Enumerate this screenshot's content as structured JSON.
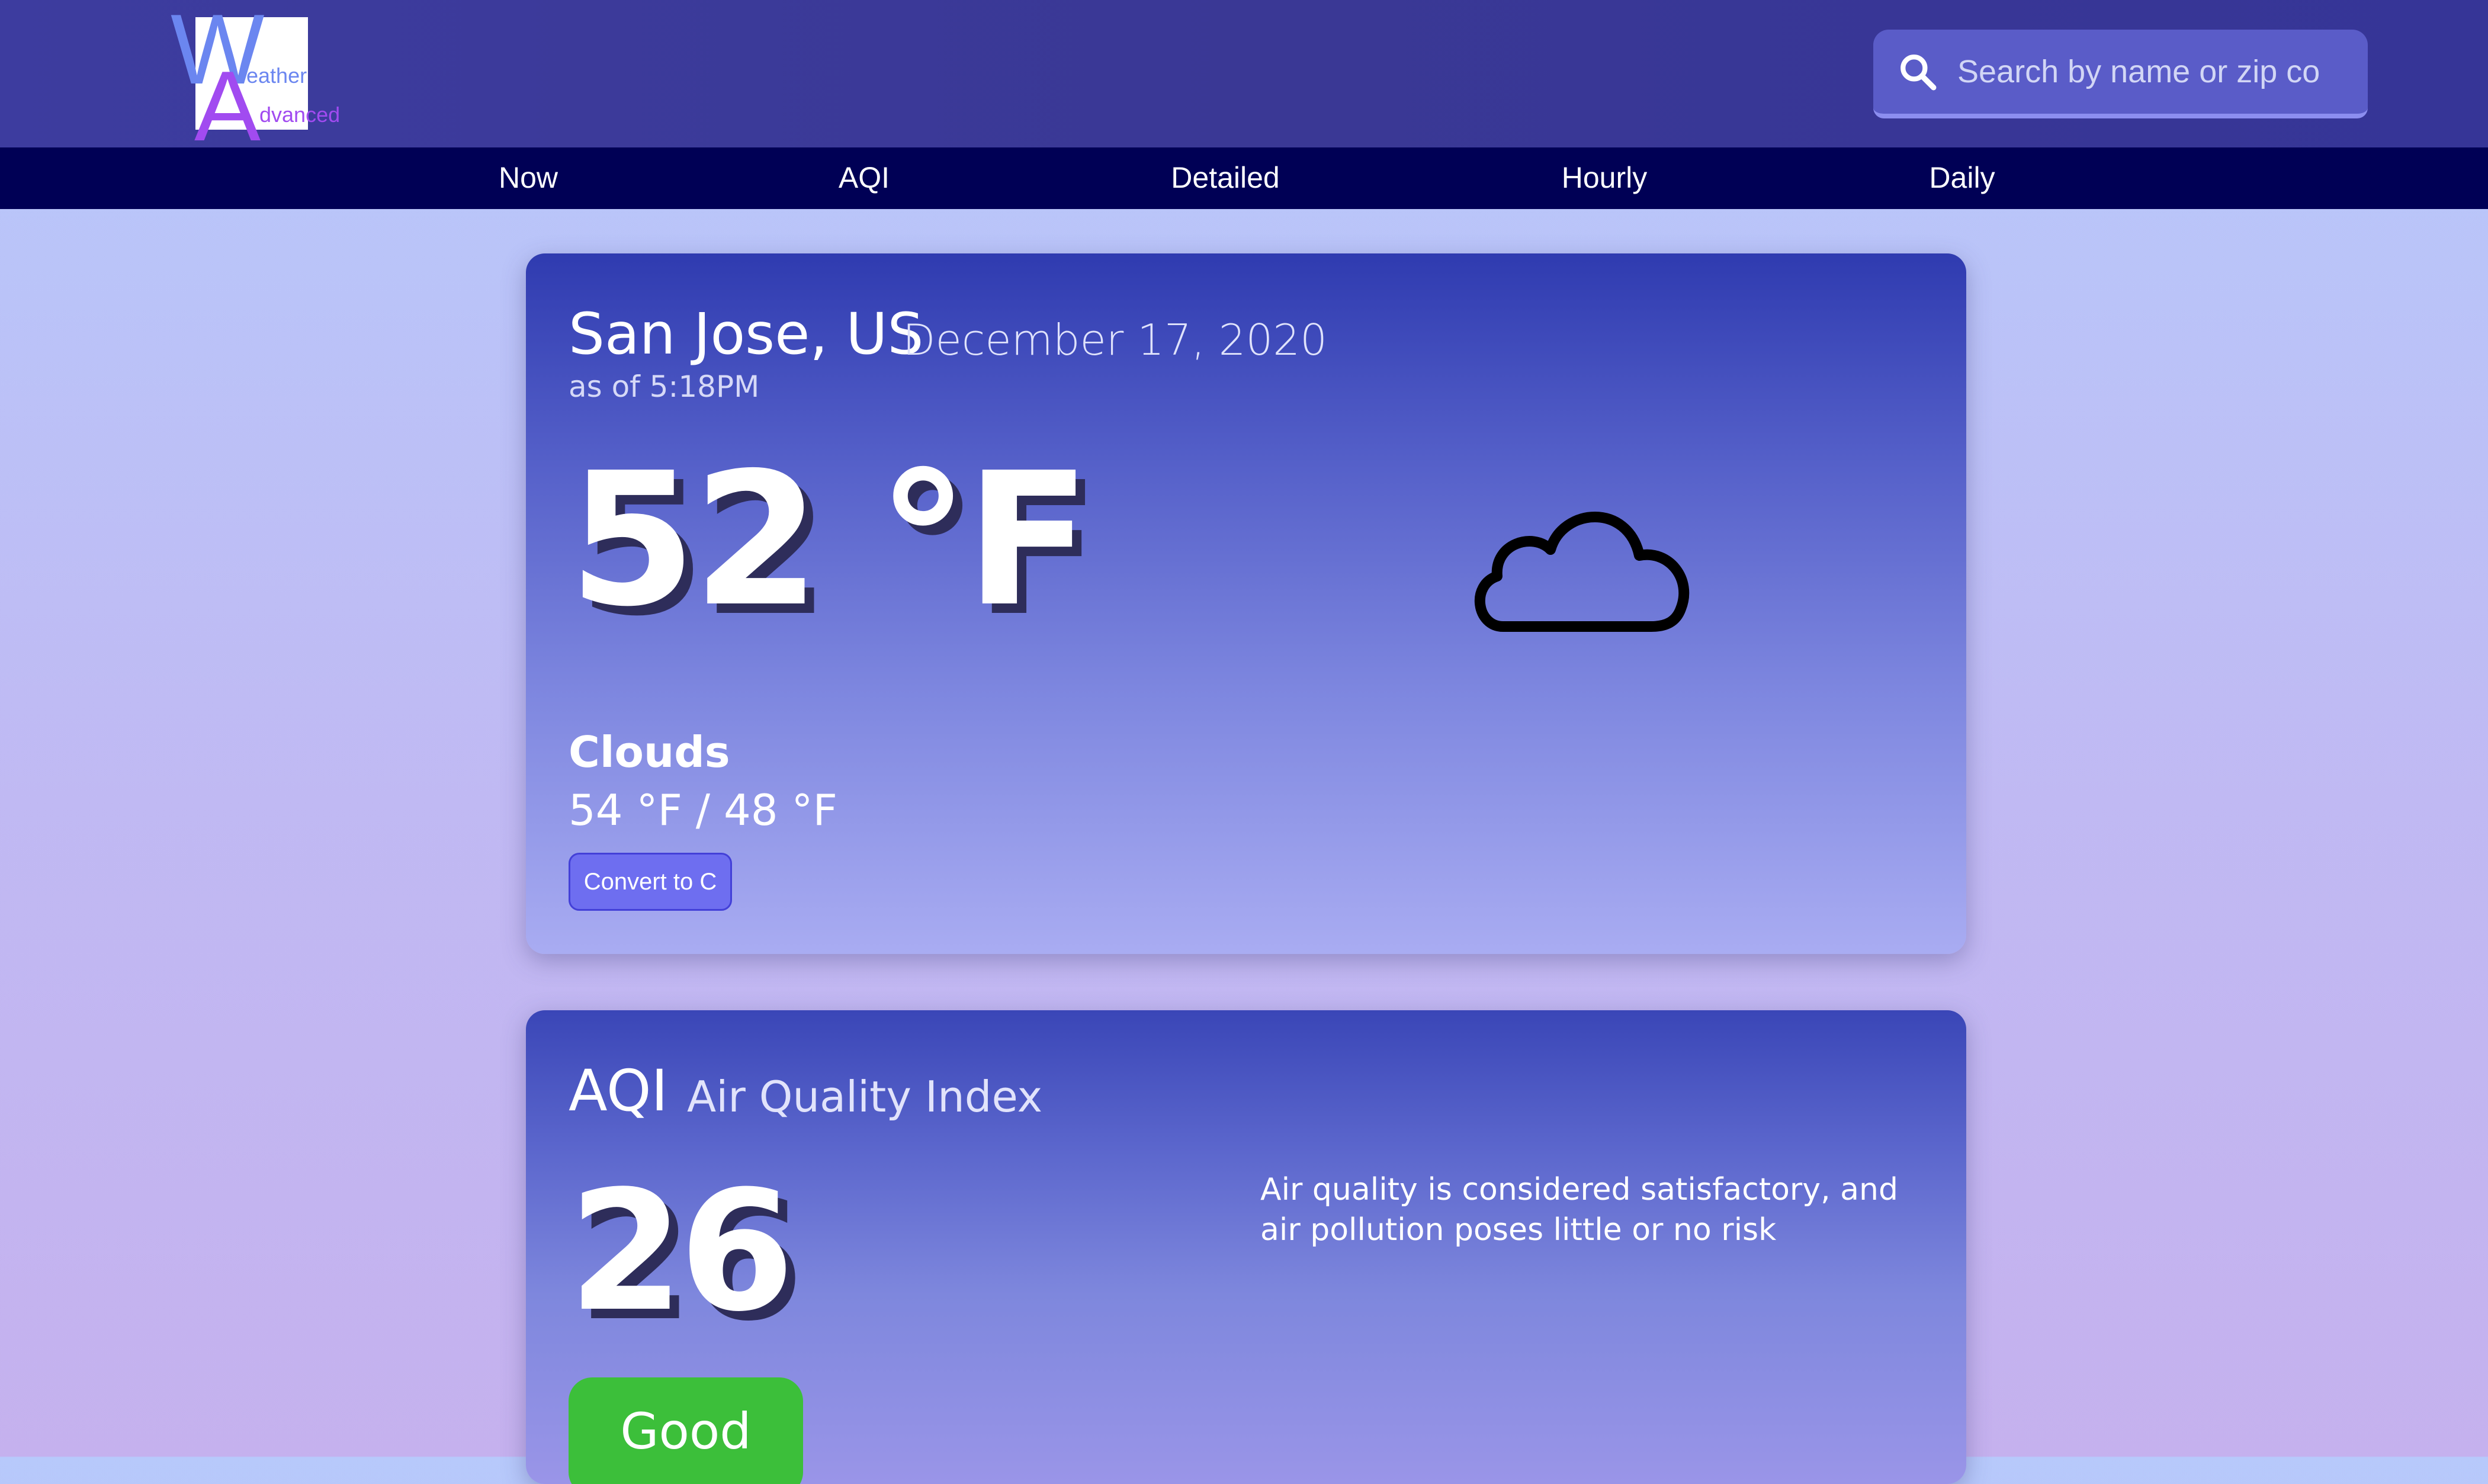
{
  "logo": {
    "w": "W",
    "eather": "eather",
    "a": "A",
    "dvanced": "dvanced"
  },
  "search": {
    "placeholder": "Search by name or zip co",
    "icon": "search-icon"
  },
  "nav": {
    "items": [
      {
        "label": "Now"
      },
      {
        "label": "AQI"
      },
      {
        "label": "Detailed"
      },
      {
        "label": "Hourly"
      },
      {
        "label": "Daily"
      }
    ]
  },
  "current": {
    "city": "San Jose, US",
    "date": "December 17, 2020",
    "as_of": "as of 5:18PM",
    "temperature": "52 °F",
    "icon": "cloud-icon",
    "condition": "Clouds",
    "hi_lo": "54 °F / 48 °F",
    "convert_label": "Convert to C"
  },
  "aqi": {
    "title": "AQI",
    "subtitle": "Air Quality Index",
    "value": "26",
    "description": "Air quality is considered satisfactory, and air pollution poses little or no risk",
    "level": "Good",
    "level_color": "#3cbf3a"
  },
  "colors": {
    "header": "#3d3c9f",
    "nav": "#000055",
    "accent": "#6e6ef0"
  }
}
